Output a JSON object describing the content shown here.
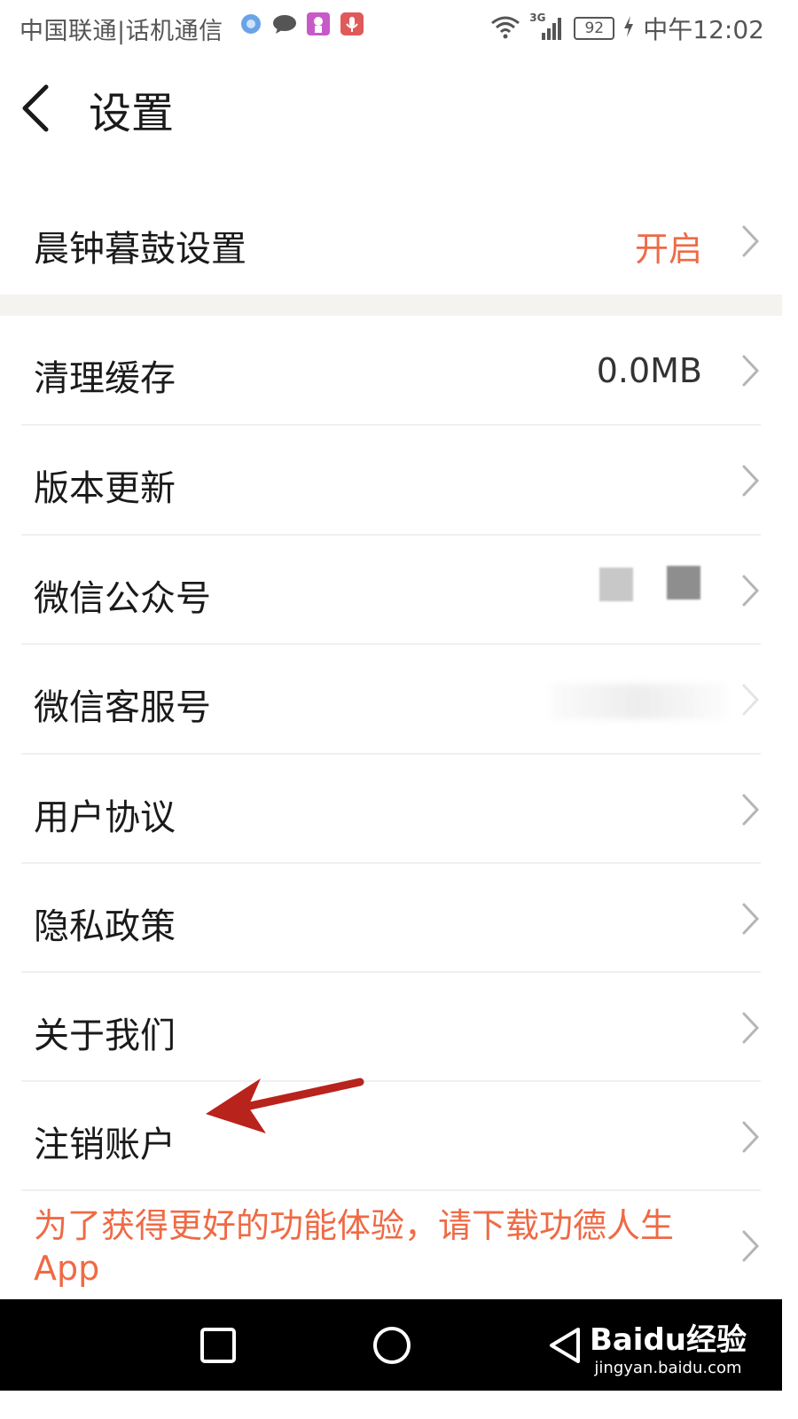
{
  "status_bar": {
    "carrier": "中国联通|话机通信",
    "network": "3G",
    "battery": "92",
    "time": "中午12:02"
  },
  "header": {
    "title": "设置"
  },
  "settings": [
    {
      "label": "晨钟暮鼓设置",
      "value": "开启"
    },
    {
      "label": "清理缓存",
      "value": "0.0MB"
    },
    {
      "label": "版本更新",
      "value": ""
    },
    {
      "label": "微信公众号",
      "value": ""
    },
    {
      "label": "微信客服号",
      "value": ""
    },
    {
      "label": "用户协议",
      "value": ""
    },
    {
      "label": "隐私政策",
      "value": ""
    },
    {
      "label": "关于我们",
      "value": ""
    },
    {
      "label": "注销账户",
      "value": ""
    }
  ],
  "promo": {
    "text": "为了获得更好的功能体验，请下载功德人生App"
  },
  "watermark": {
    "main": "Baidu经验",
    "sub": "jingyan.baidu.com"
  },
  "colors": {
    "accent": "#ef6a45",
    "arrow": "#b8231b"
  }
}
